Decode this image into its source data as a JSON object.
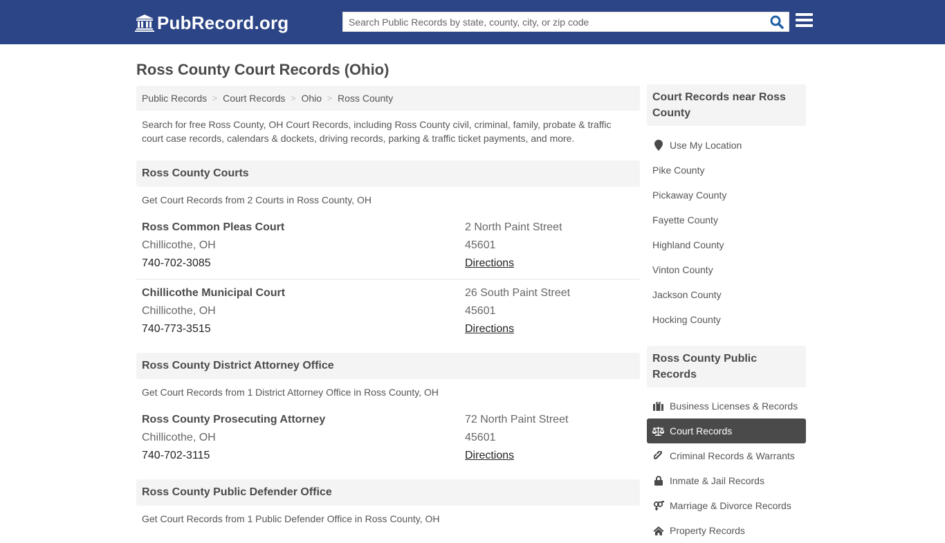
{
  "header": {
    "logo_text": "PubRecord.org",
    "search_placeholder": "Search Public Records by state, county, city, or zip code",
    "brand_color": "#2c4586",
    "search_icon_color": "#1f5fa6"
  },
  "page": {
    "title": "Ross County Court Records (Ohio)",
    "intro": "Search for free Ross County, OH Court Records, including Ross County civil, criminal, family, probate & traffic court case records, calendars & dockets, driving records, parking & traffic ticket payments, and more."
  },
  "breadcrumb": [
    {
      "label": "Public Records"
    },
    {
      "label": "Court Records"
    },
    {
      "label": "Ohio"
    },
    {
      "label": "Ross County"
    }
  ],
  "sections": [
    {
      "title": "Ross County Courts",
      "subtitle": "Get Court Records from 2 Courts in Ross County, OH",
      "entries": [
        {
          "name": "Ross Common Pleas Court",
          "city": "Chillicothe, OH",
          "phone": "740-702-3085",
          "address": "2 North Paint Street",
          "zip": "45601",
          "directions": "Directions"
        },
        {
          "name": "Chillicothe Municipal Court",
          "city": "Chillicothe, OH",
          "phone": "740-773-3515",
          "address": "26 South Paint Street",
          "zip": "45601",
          "directions": "Directions"
        }
      ]
    },
    {
      "title": "Ross County District Attorney Office",
      "subtitle": "Get Court Records from 1 District Attorney Office in Ross County, OH",
      "entries": [
        {
          "name": "Ross County Prosecuting Attorney",
          "city": "Chillicothe, OH",
          "phone": "740-702-3115",
          "address": "72 North Paint Street",
          "zip": "45601",
          "directions": "Directions"
        }
      ]
    },
    {
      "title": "Ross County Public Defender Office",
      "subtitle": "Get Court Records from 1 Public Defender Office in Ross County, OH",
      "entries": []
    }
  ],
  "sidebar": {
    "nearby": {
      "title": "Court Records near Ross County",
      "use_location": {
        "label": "Use My Location",
        "icon": "map-marker-icon"
      },
      "items": [
        {
          "label": "Pike County"
        },
        {
          "label": "Pickaway County"
        },
        {
          "label": "Fayette County"
        },
        {
          "label": "Highland County"
        },
        {
          "label": "Vinton County"
        },
        {
          "label": "Jackson County"
        },
        {
          "label": "Hocking County"
        }
      ]
    },
    "public_records": {
      "title": "Ross County Public Records",
      "items": [
        {
          "label": "Business Licenses & Records",
          "icon": "briefcase-icon",
          "active": false
        },
        {
          "label": "Court Records",
          "icon": "balance-scale-icon",
          "active": true
        },
        {
          "label": "Criminal Records & Warrants",
          "icon": "link-icon",
          "active": false
        },
        {
          "label": "Inmate & Jail Records",
          "icon": "lock-icon",
          "active": false
        },
        {
          "label": "Marriage & Divorce Records",
          "icon": "venus-mars-icon",
          "active": false
        },
        {
          "label": "Property Records",
          "icon": "home-icon",
          "active": false
        }
      ]
    }
  }
}
